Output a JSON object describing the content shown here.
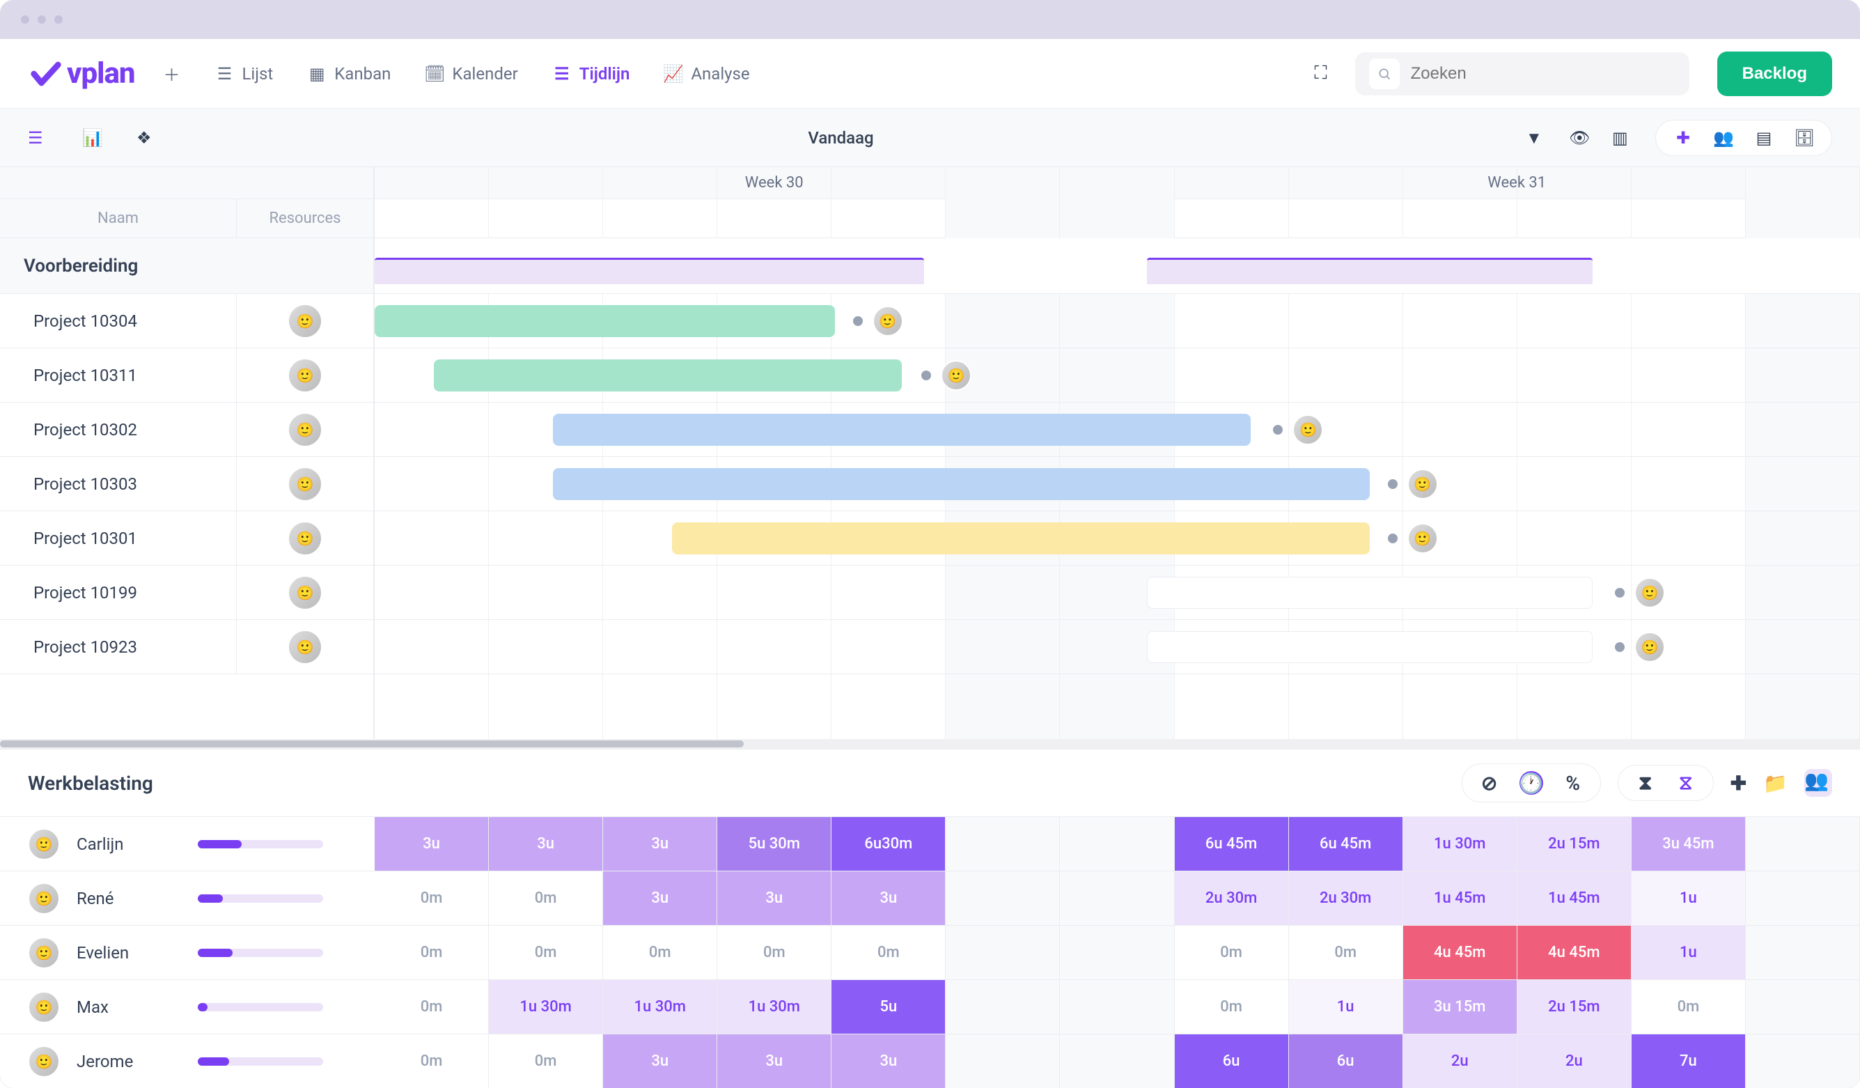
{
  "app": {
    "logo": "vplan"
  },
  "views": {
    "list": "Lijst",
    "kanban": "Kanban",
    "calendar": "Kalender",
    "timeline": "Tijdlijn",
    "analyse": "Analyse"
  },
  "search": {
    "placeholder": "Zoeken"
  },
  "buttons": {
    "backlog": "Backlog"
  },
  "toolbar": {
    "today": "Vandaag"
  },
  "columns": {
    "name": "Naam",
    "resources": "Resources"
  },
  "weeks": [
    "Week 30",
    "Week 31"
  ],
  "group": {
    "name": "Voorbereiding"
  },
  "projects": [
    {
      "name": "Project 10304",
      "barClass": "green",
      "barLeft": 0,
      "barWidth": 31,
      "afterLeft": 32.2
    },
    {
      "name": "Project 10311",
      "barClass": "green",
      "barLeft": 4,
      "barWidth": 31.5,
      "afterLeft": 36.8
    },
    {
      "name": "Project 10302",
      "barClass": "blue",
      "barLeft": 12,
      "barWidth": 47,
      "afterLeft": 60.5
    },
    {
      "name": "Project 10303",
      "barClass": "blue",
      "barLeft": 12,
      "barWidth": 55,
      "afterLeft": 68.2
    },
    {
      "name": "Project 10301",
      "barClass": "yellow",
      "barLeft": 20,
      "barWidth": 47,
      "afterLeft": 68.2
    },
    {
      "name": "Project 10199",
      "barClass": "white",
      "barLeft": 52,
      "barWidth": 30,
      "afterLeft": 83.5
    },
    {
      "name": "Project 10923",
      "barClass": "white",
      "barLeft": 52,
      "barWidth": 30,
      "afterLeft": 83.5
    }
  ],
  "workload": {
    "title": "Werkbelasting",
    "people": [
      {
        "name": "Carlijn",
        "progress": 35,
        "cells": [
          {
            "v": "3u",
            "c": "l2"
          },
          {
            "v": "3u",
            "c": "l2"
          },
          {
            "v": "3u",
            "c": "l2"
          },
          {
            "v": "5u 30m",
            "c": "l3"
          },
          {
            "v": "6u30m",
            "c": "l4"
          },
          {
            "v": "",
            "c": "weekend"
          },
          {
            "v": "",
            "c": "weekend"
          },
          {
            "v": "6u 45m",
            "c": "l4"
          },
          {
            "v": "6u 45m",
            "c": "l4"
          },
          {
            "v": "1u 30m",
            "c": "l1"
          },
          {
            "v": "2u 15m",
            "c": "l1"
          },
          {
            "v": "3u 45m",
            "c": "l2"
          },
          {
            "v": "",
            "c": "weekend"
          }
        ]
      },
      {
        "name": "René",
        "progress": 20,
        "cells": [
          {
            "v": "0m",
            "c": "em"
          },
          {
            "v": "0m",
            "c": "em"
          },
          {
            "v": "3u",
            "c": "l2"
          },
          {
            "v": "3u",
            "c": "l2"
          },
          {
            "v": "3u",
            "c": "l2"
          },
          {
            "v": "",
            "c": "weekend"
          },
          {
            "v": "",
            "c": "weekend"
          },
          {
            "v": "2u 30m",
            "c": "l1"
          },
          {
            "v": "2u 30m",
            "c": "l1"
          },
          {
            "v": "1u 45m",
            "c": "l1"
          },
          {
            "v": "1u 45m",
            "c": "l1"
          },
          {
            "v": "1u",
            "c": "l0"
          },
          {
            "v": "",
            "c": "weekend"
          }
        ]
      },
      {
        "name": "Evelien",
        "progress": 28,
        "cells": [
          {
            "v": "0m",
            "c": "em"
          },
          {
            "v": "0m",
            "c": "em"
          },
          {
            "v": "0m",
            "c": "em"
          },
          {
            "v": "0m",
            "c": "em"
          },
          {
            "v": "0m",
            "c": "em"
          },
          {
            "v": "",
            "c": "weekend"
          },
          {
            "v": "",
            "c": "weekend"
          },
          {
            "v": "0m",
            "c": "em"
          },
          {
            "v": "0m",
            "c": "em"
          },
          {
            "v": "4u 45m",
            "c": "red"
          },
          {
            "v": "4u 45m",
            "c": "red"
          },
          {
            "v": "1u",
            "c": "l1"
          },
          {
            "v": "",
            "c": "weekend"
          }
        ]
      },
      {
        "name": "Max",
        "progress": 8,
        "cells": [
          {
            "v": "0m",
            "c": "em"
          },
          {
            "v": "1u 30m",
            "c": "l1"
          },
          {
            "v": "1u 30m",
            "c": "l1"
          },
          {
            "v": "1u 30m",
            "c": "l1"
          },
          {
            "v": "5u",
            "c": "l4"
          },
          {
            "v": "",
            "c": "weekend"
          },
          {
            "v": "",
            "c": "weekend"
          },
          {
            "v": "0m",
            "c": "em"
          },
          {
            "v": "1u",
            "c": "l0"
          },
          {
            "v": "3u 15m",
            "c": "l2"
          },
          {
            "v": "2u 15m",
            "c": "l1"
          },
          {
            "v": "0m",
            "c": "em"
          },
          {
            "v": "",
            "c": "weekend"
          }
        ]
      },
      {
        "name": "Jerome",
        "progress": 25,
        "cells": [
          {
            "v": "0m",
            "c": "em"
          },
          {
            "v": "0m",
            "c": "em"
          },
          {
            "v": "3u",
            "c": "l2"
          },
          {
            "v": "3u",
            "c": "l2"
          },
          {
            "v": "3u",
            "c": "l2"
          },
          {
            "v": "",
            "c": "weekend"
          },
          {
            "v": "",
            "c": "weekend"
          },
          {
            "v": "6u",
            "c": "l4"
          },
          {
            "v": "6u",
            "c": "l3"
          },
          {
            "v": "2u",
            "c": "l1"
          },
          {
            "v": "2u",
            "c": "l1"
          },
          {
            "v": "7u",
            "c": "l4"
          },
          {
            "v": "",
            "c": "weekend"
          }
        ]
      }
    ]
  }
}
